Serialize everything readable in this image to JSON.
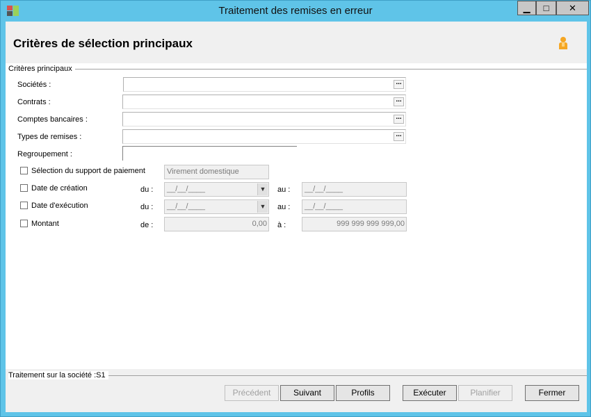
{
  "window": {
    "title": "Traitement des remises en erreur",
    "controls": {
      "minimize": "▁",
      "maximize": "□",
      "close": "✕"
    }
  },
  "header": {
    "title": "Critères de sélection principaux",
    "user_icon": "user-icon"
  },
  "group": {
    "legend": "Critères principaux"
  },
  "fields": {
    "societes": {
      "label": "Sociétés :",
      "value": "",
      "button": "..."
    },
    "contrats": {
      "label": "Contrats :",
      "value": "",
      "button": "..."
    },
    "comptes": {
      "label": "Comptes bancaires :",
      "value": "",
      "button": "..."
    },
    "types": {
      "label": "Types de remises :",
      "value": "",
      "button": "..."
    },
    "regroupement": {
      "label": "Regroupement :",
      "value": ""
    }
  },
  "options": {
    "support": {
      "label": "Sélection du support de paiement",
      "checked": false,
      "value": "Virement domestique"
    },
    "creation": {
      "label": "Date de création",
      "checked": false,
      "from_label": "du :",
      "from": "__/__/____",
      "to_label": "au :",
      "to": "__/__/____"
    },
    "execution": {
      "label": "Date d'exécution",
      "checked": false,
      "from_label": "du :",
      "from": "__/__/____",
      "to_label": "au :",
      "to": "__/__/____"
    },
    "montant": {
      "label": "Montant",
      "checked": false,
      "from_label": "de :",
      "from": "0,00",
      "to_label": "à :",
      "to": "999 999 999 999,00"
    }
  },
  "footer": {
    "status": "Traitement sur la société :S1",
    "buttons": {
      "precedent": "Précédent",
      "suivant": "Suivant",
      "profils": "Profils",
      "executer": "Exécuter",
      "planifier": "Planifier",
      "fermer": "Fermer"
    }
  },
  "colors": {
    "title_bar": "#5fc4e8",
    "header_bg": "#f0f0f0",
    "user_icon": "#f5a623"
  }
}
